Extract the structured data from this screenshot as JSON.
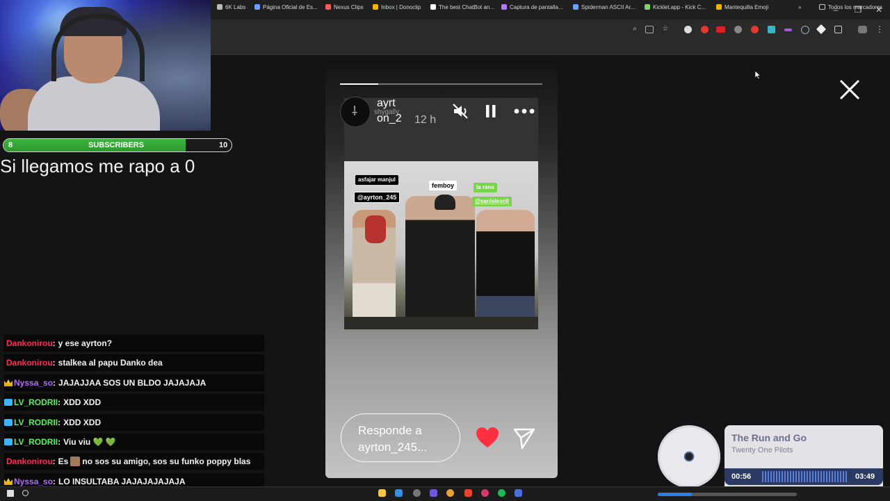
{
  "subscriber_goal": {
    "current": "8",
    "label": "SUBSCRIBERS",
    "target": "10",
    "progress_fraction": 0.8,
    "bar_color": "#3cb33d",
    "message": "Si llegamos me rapo a 0"
  },
  "browser": {
    "bookmarks": [
      {
        "label": "6K Labs",
        "color": "#bbbbbb"
      },
      {
        "label": "Página Oficial de Es...",
        "color": "#6aa0ff"
      },
      {
        "label": "Nexus Clips",
        "color": "#ff5a5a"
      },
      {
        "label": "Inbox | Donoclip",
        "color": "#f6b400"
      },
      {
        "label": "The best ChatBot an...",
        "color": "#ffffff"
      },
      {
        "label": "Captura de pantalla...",
        "color": "#b07cff"
      },
      {
        "label": "Spiderman ASCII Ar...",
        "color": "#6aa0ff"
      },
      {
        "label": "Kicklet.app - Kick C...",
        "color": "#7cd46a"
      },
      {
        "label": "Mantequilla Emoji",
        "color": "#f6b400"
      }
    ],
    "other_bookmarks": "Todos los marcadores",
    "window_controls": [
      "–",
      "❐",
      "✕"
    ]
  },
  "story": {
    "username_line1": "ayrt",
    "username_line2": "on_2",
    "music_text": "shygally",
    "time_ago": "12 h",
    "progress_fraction": 0.19,
    "tags": {
      "tag1_title": "asfajar manjul",
      "tag1_handle": "@ayrton_245",
      "tag2_title": "femboy",
      "tag3_title": "la rana",
      "tag3_handle": "@sanlolesc0"
    },
    "reply_placeholder": "Responde a ayrton_245...",
    "heart_color": "#ff3040"
  },
  "chat": [
    {
      "user": "Dankonirou",
      "color": "#ff2d55",
      "badge": "",
      "message": "y ese ayrton?"
    },
    {
      "user": "Dankonirou",
      "color": "#ff2d55",
      "badge": "",
      "message": "stalkea al papu Danko dea"
    },
    {
      "user": "Nyssa_so",
      "color": "#b36bff",
      "badge": "crown",
      "message": "JAJAJJAA SOS UN BLDO JAJAJAJA"
    },
    {
      "user": "LV_RODRII",
      "color": "#5cf05c",
      "badge": "sub",
      "message": "XDD XDD"
    },
    {
      "user": "LV_RODRII",
      "color": "#5cf05c",
      "badge": "sub",
      "message": "XDD XDD"
    },
    {
      "user": "LV_RODRII",
      "color": "#5cf05c",
      "badge": "sub",
      "message": "Viu viu 💚 💚"
    },
    {
      "user": "Dankonirou",
      "color": "#ff2d55",
      "badge": "",
      "message_before": "Es",
      "message_after": "no sos su amigo, sos su funko poppy blas"
    },
    {
      "user": "Nyssa_so",
      "color": "#b36bff",
      "badge": "crown",
      "message": "LO INSULTABA JAJAJAJAJAJA"
    }
  ],
  "now_playing": {
    "title": "The Run and Go",
    "artist": "Twenty One Pilots",
    "elapsed": "00:56",
    "duration": "03:49",
    "progress_fraction": 0.245,
    "accent": "#2b3a63"
  },
  "icons": {
    "close": "close-icon",
    "mute": "mute-icon",
    "pause": "pause-icon",
    "more": "more-icon",
    "heart": "heart-icon",
    "send": "send-icon"
  }
}
